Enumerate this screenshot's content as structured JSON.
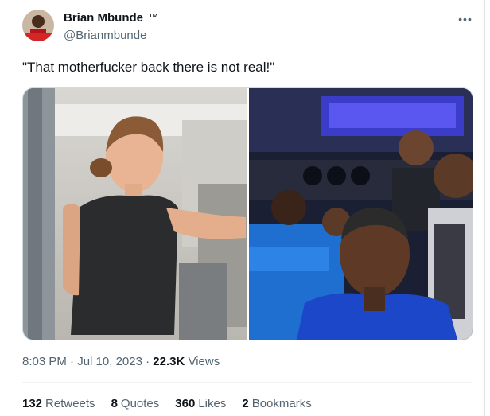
{
  "author": {
    "name": "Brian Mbunde",
    "badge": "™",
    "handle": "@Brianmbunde"
  },
  "more_icon": "•••",
  "tweet": {
    "text": "\"That motherfucker back there is not real!\""
  },
  "media": {
    "left": "photo-woman-airplane-aisle",
    "right": "photo-men-in-matatu-bus"
  },
  "meta": {
    "time": "8:03 PM",
    "sep1": " · ",
    "date": "Jul 10, 2023",
    "sep2": " · ",
    "views_count": "22.3K",
    "views_label": " Views"
  },
  "stats": [
    {
      "count": "132",
      "label": "Retweets"
    },
    {
      "count": "8",
      "label": "Quotes"
    },
    {
      "count": "360",
      "label": "Likes"
    },
    {
      "count": "2",
      "label": "Bookmarks"
    }
  ],
  "colors": {
    "text": "#0f1419",
    "secondary": "#536471",
    "border": "#cfd9de"
  }
}
